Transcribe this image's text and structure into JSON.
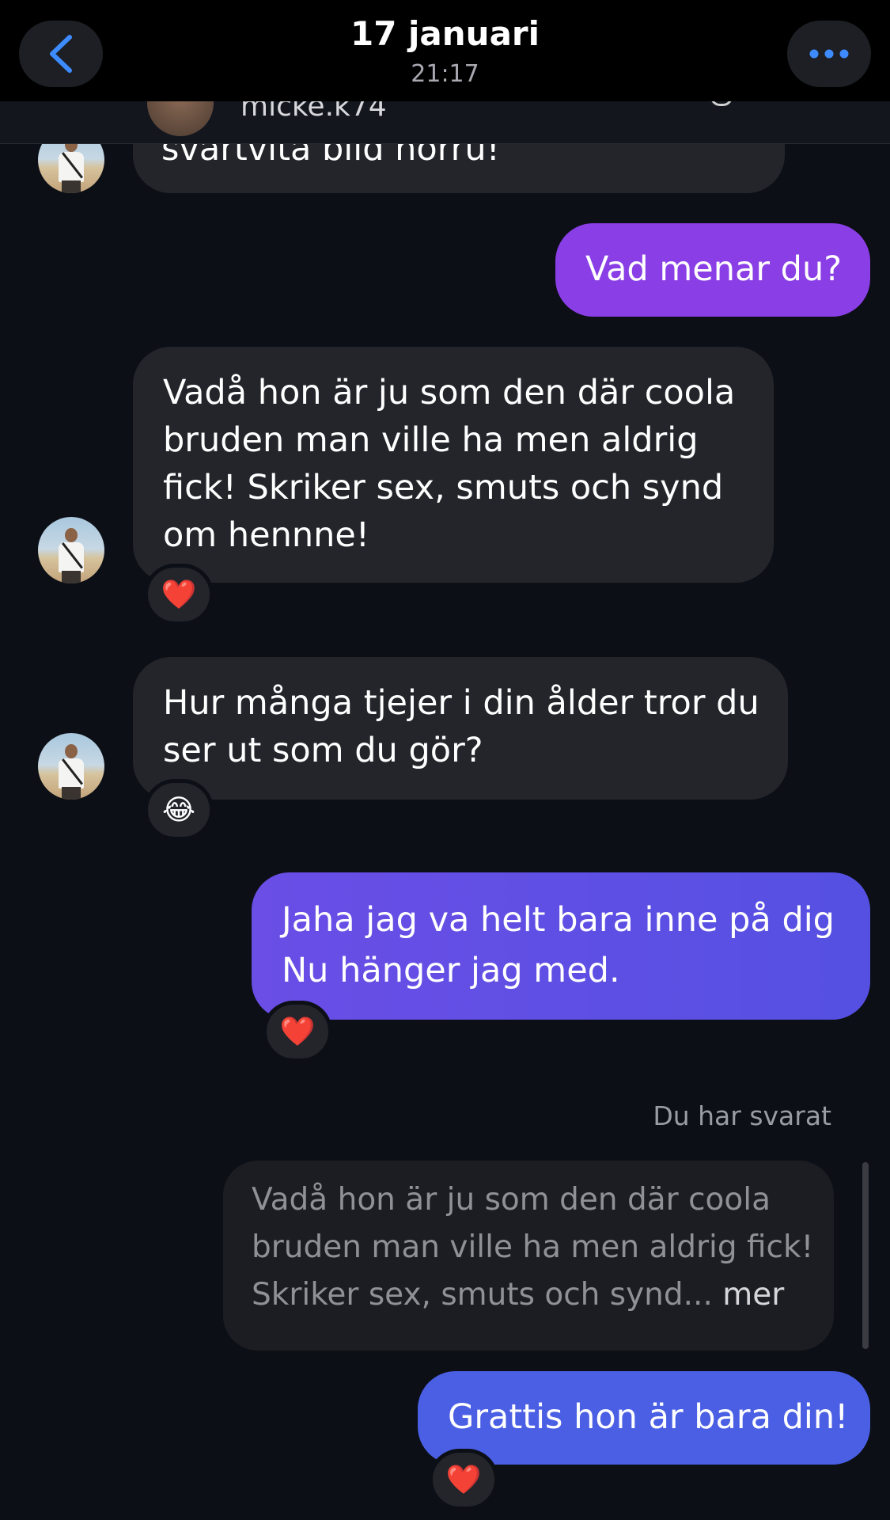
{
  "header": {
    "title": "17 januari",
    "subtitle": "21:17",
    "back_icon": "chevron-left-icon",
    "more_icon": "ellipsis-icon",
    "accent": "#3d8bff"
  },
  "peek": {
    "username": "micke.k74"
  },
  "messages": [
    {
      "id": "m0",
      "direction": "in",
      "lines": [
        "svartvita bild norru!"
      ]
    },
    {
      "id": "m1",
      "direction": "out",
      "lines": [
        "Vad menar du?"
      ],
      "color": "#8a3ee6"
    },
    {
      "id": "m2",
      "direction": "in",
      "lines": [
        "Vadå hon är ju som den där coola",
        "bruden man ville ha men aldrig",
        "fick! Skriker sex, smuts och synd",
        "om hennne!"
      ],
      "reaction": "❤️"
    },
    {
      "id": "m3",
      "direction": "in",
      "lines": [
        "Hur många tjejer i din ålder tror du",
        "ser ut som du gör?"
      ],
      "reaction": "😂"
    },
    {
      "id": "m4",
      "direction": "out",
      "lines": [
        "Jaha jag va helt bara inne på dig",
        "Nu hänger jag med."
      ],
      "reaction": "❤️",
      "color": "#5f4fe2"
    },
    {
      "id": "m5",
      "direction": "out",
      "lines": [
        "Grattis hon är bara din!"
      ],
      "reaction": "❤️",
      "color": "#4a5fe4"
    }
  ],
  "reply": {
    "label": "Du har svarat",
    "quoted_lines": [
      "Vadå hon är ju som den där coola",
      "bruden man ville ha men aldrig fick!",
      "Skriker sex, smuts och synd..."
    ],
    "more_label": "mer"
  }
}
